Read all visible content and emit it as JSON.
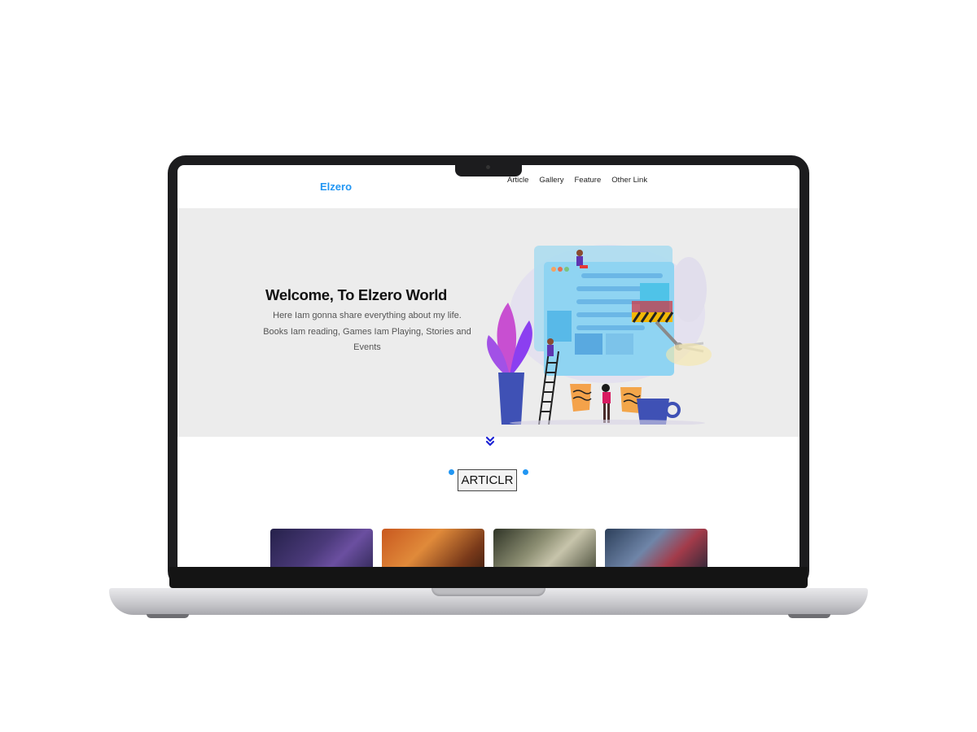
{
  "header": {
    "logo": "Elzero",
    "nav": [
      "Article",
      "Gallery",
      "Feature",
      "Other Link"
    ]
  },
  "hero": {
    "title": "Welcome, To Elzero World",
    "text": "Here Iam gonna share everything about my life. Books Iam reading, Games Iam Playing, Stories and Events"
  },
  "articles": {
    "heading": "ARTICLR"
  },
  "colors": {
    "accent": "#2196f3",
    "hero_bg": "#ececec"
  },
  "icons": {
    "scroll": "double-chevron-down-icon"
  }
}
